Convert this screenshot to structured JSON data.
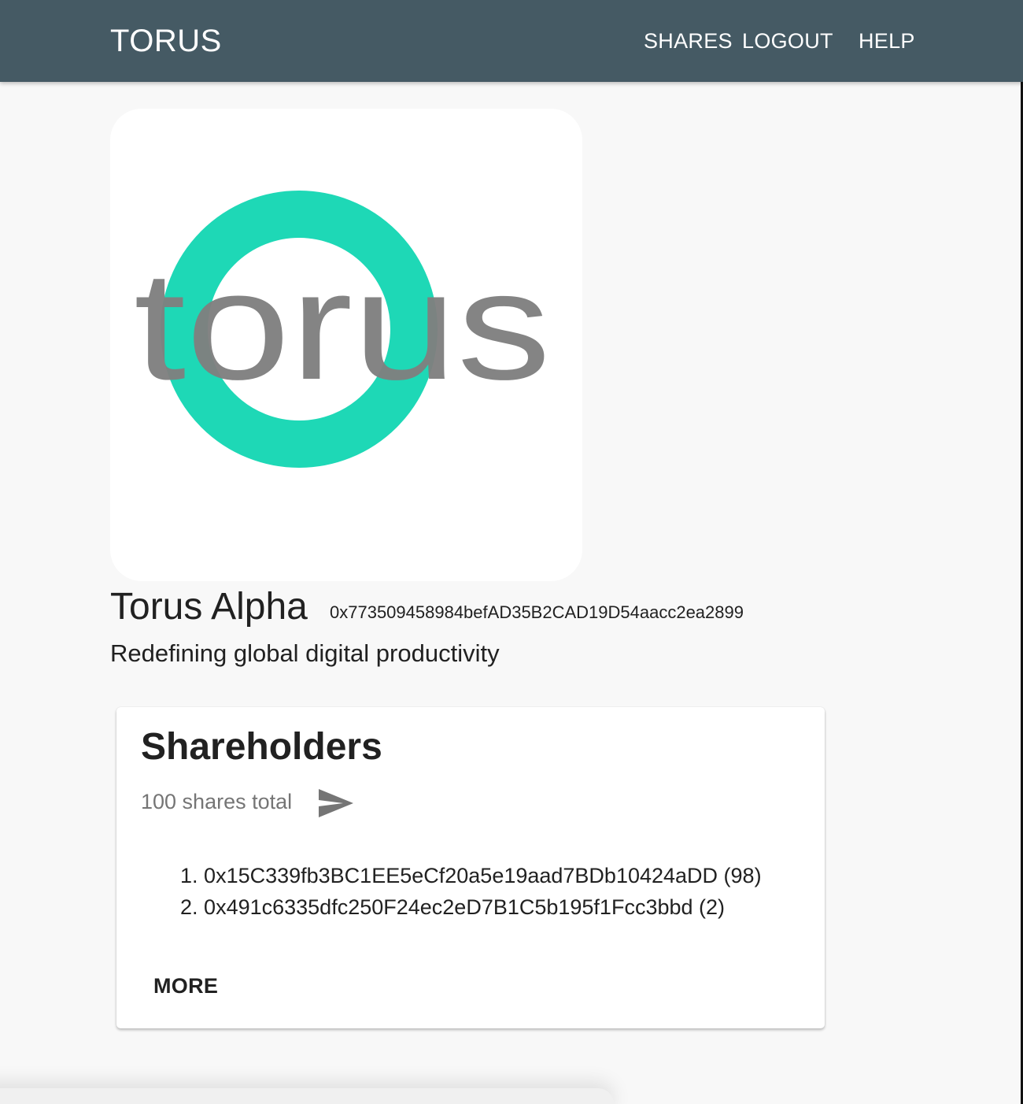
{
  "header": {
    "brand": "TORUS",
    "nav": {
      "shares": "SHARES",
      "logout": "LOGOUT",
      "help": "HELP"
    }
  },
  "logo": {
    "wordmark": "torus",
    "ring_color": "#1ED8B6",
    "text_color": "#7F7F7F"
  },
  "company": {
    "name": "Torus Alpha",
    "address": "0x773509458984befAD35B2CAD19D54aacc2ea2899",
    "tagline": "Redefining global digital productivity"
  },
  "shareholders": {
    "title": "Shareholders",
    "total": "100 shares total",
    "send_icon": "send-icon",
    "items": [
      {
        "number": "1.",
        "text": "0x15C339fb3BC1EE5eCf20a5e19aad7BDb10424aDD (98)"
      },
      {
        "number": "2.",
        "text": "0x491c6335dfc250F24ec2eD7B1C5b195f1Fcc3bbd (2)"
      }
    ],
    "more_label": "MORE"
  },
  "colors": {
    "app_bar": "#455A64",
    "background": "#F8F8F8",
    "accent": "#1ED8B6"
  }
}
